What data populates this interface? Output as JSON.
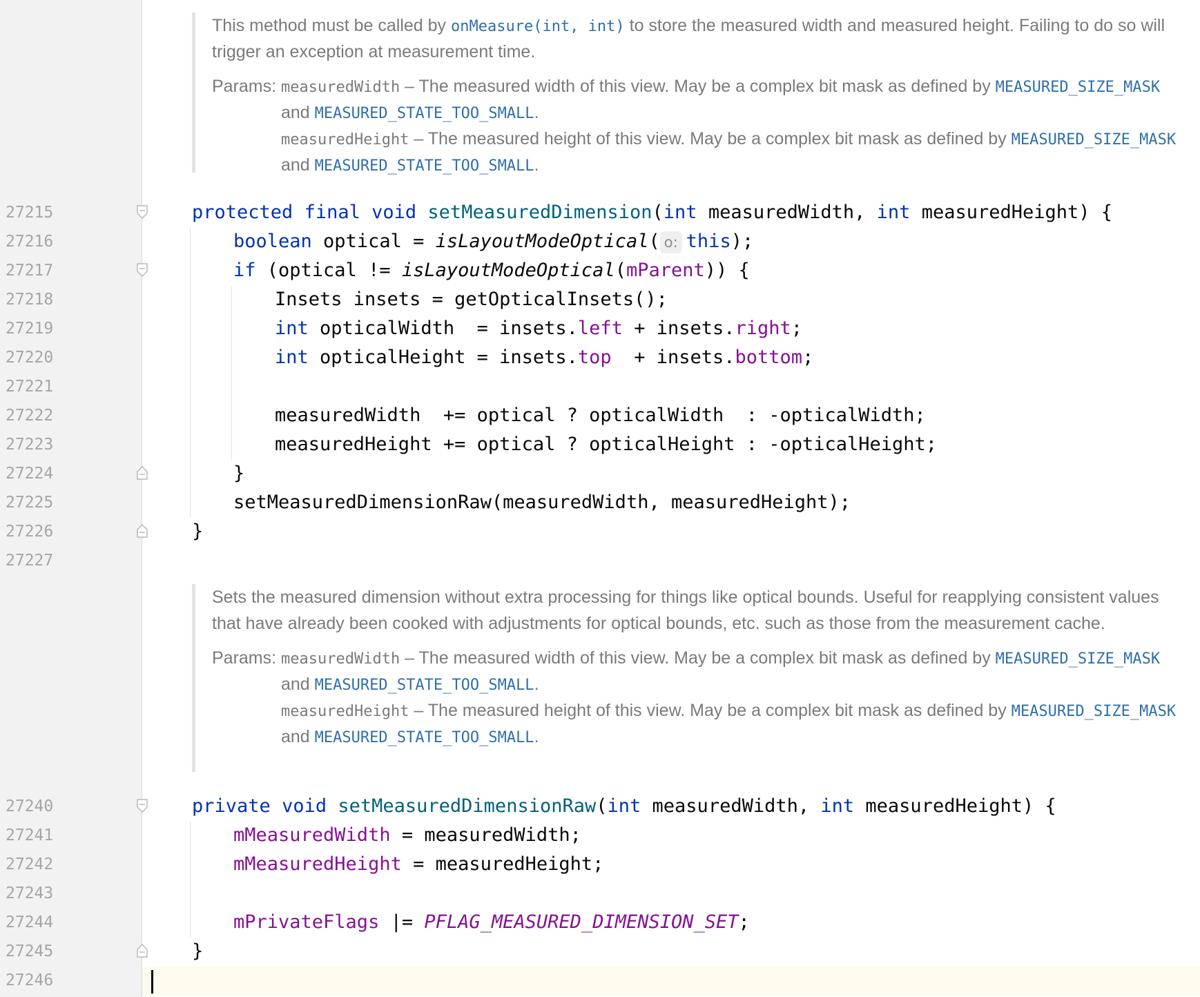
{
  "doc1": {
    "desc_before": "This method must be called by ",
    "desc_link": "onMeasure(int, int)",
    "desc_after": " to store the measured width and measured height. Failing to do so will trigger an exception at measurement time.",
    "params_label": "Params:",
    "p1_name": "measuredWidth",
    "p1_text": " – The measured width of this view. May be a complex bit mask as defined by ",
    "p1_link1": "MEASURED_SIZE_MASK",
    "p1_and": " and ",
    "p1_link2": "MEASURED_STATE_TOO_SMALL",
    "p1_end": ".",
    "p2_name": "measuredHeight",
    "p2_text": " – The measured height of this view. May be a complex bit mask as defined by ",
    "p2_link1": "MEASURED_SIZE_MASK",
    "p2_and": " and ",
    "p2_link2": "MEASURED_STATE_TOO_SMALL",
    "p2_end": "."
  },
  "doc2": {
    "desc": "Sets the measured dimension without extra processing for things like optical bounds. Useful for reapplying consistent values that have already been cooked with adjustments for optical bounds, etc. such as those from the measurement cache.",
    "params_label": "Params:",
    "p1_name": "measuredWidth",
    "p1_text": " – The measured width of this view. May be a complex bit mask as defined by ",
    "p1_link1": "MEASURED_SIZE_MASK",
    "p1_and": " and ",
    "p1_link2": "MEASURED_STATE_TOO_SMALL",
    "p1_end": ".",
    "p2_name": "measuredHeight",
    "p2_text": " – The measured height of this view. May be a complex bit mask as defined by ",
    "p2_link1": "MEASURED_SIZE_MASK",
    "p2_and": " and ",
    "p2_link2": "MEASURED_STATE_TOO_SMALL",
    "p2_end": "."
  },
  "line_numbers": [
    "27215",
    "27216",
    "27217",
    "27218",
    "27219",
    "27220",
    "27221",
    "27222",
    "27223",
    "27224",
    "27225",
    "27226",
    "27227",
    "27240",
    "27241",
    "27242",
    "27243",
    "27244",
    "27245",
    "27246"
  ],
  "code": {
    "l27215": [
      "protected",
      " ",
      "final",
      " ",
      "void",
      " ",
      "setMeasuredDimension",
      "(",
      "int",
      " measuredWidth, ",
      "int",
      " measuredHeight) {"
    ],
    "l27216": [
      "boolean",
      " optical = ",
      "isLayoutModeOptical",
      "(",
      "o:",
      "this",
      ");"
    ],
    "l27217": [
      "if",
      " (optical != ",
      "isLayoutModeOptical",
      "(",
      "mParent",
      ")) {"
    ],
    "l27218": [
      "Insets insets = getOpticalInsets();"
    ],
    "l27219": [
      "int",
      " opticalWidth  = insets.",
      "left",
      " + insets.",
      "right",
      ";"
    ],
    "l27220": [
      "int",
      " opticalHeight = insets.",
      "top",
      "  + insets.",
      "bottom",
      ";"
    ],
    "l27222": [
      "measuredWidth  += optical ? opticalWidth  : -opticalWidth;"
    ],
    "l27223": [
      "measuredHeight += optical ? opticalHeight : -opticalHeight;"
    ],
    "l27224": [
      "}"
    ],
    "l27225": [
      "setMeasuredDimensionRaw(measuredWidth, measuredHeight);"
    ],
    "l27226": [
      "}"
    ],
    "l27240": [
      "private",
      " ",
      "void",
      " ",
      "setMeasuredDimensionRaw",
      "(",
      "int",
      " measuredWidth, ",
      "int",
      " measuredHeight) {"
    ],
    "l27241": [
      "mMeasuredWidth",
      " = measuredWidth;"
    ],
    "l27242": [
      "mMeasuredHeight",
      " = measuredHeight;"
    ],
    "l27244": [
      "mPrivateFlags",
      " |= ",
      "PFLAG_MEASURED_DIMENSION_SET",
      ";"
    ],
    "l27245": [
      "}"
    ]
  }
}
